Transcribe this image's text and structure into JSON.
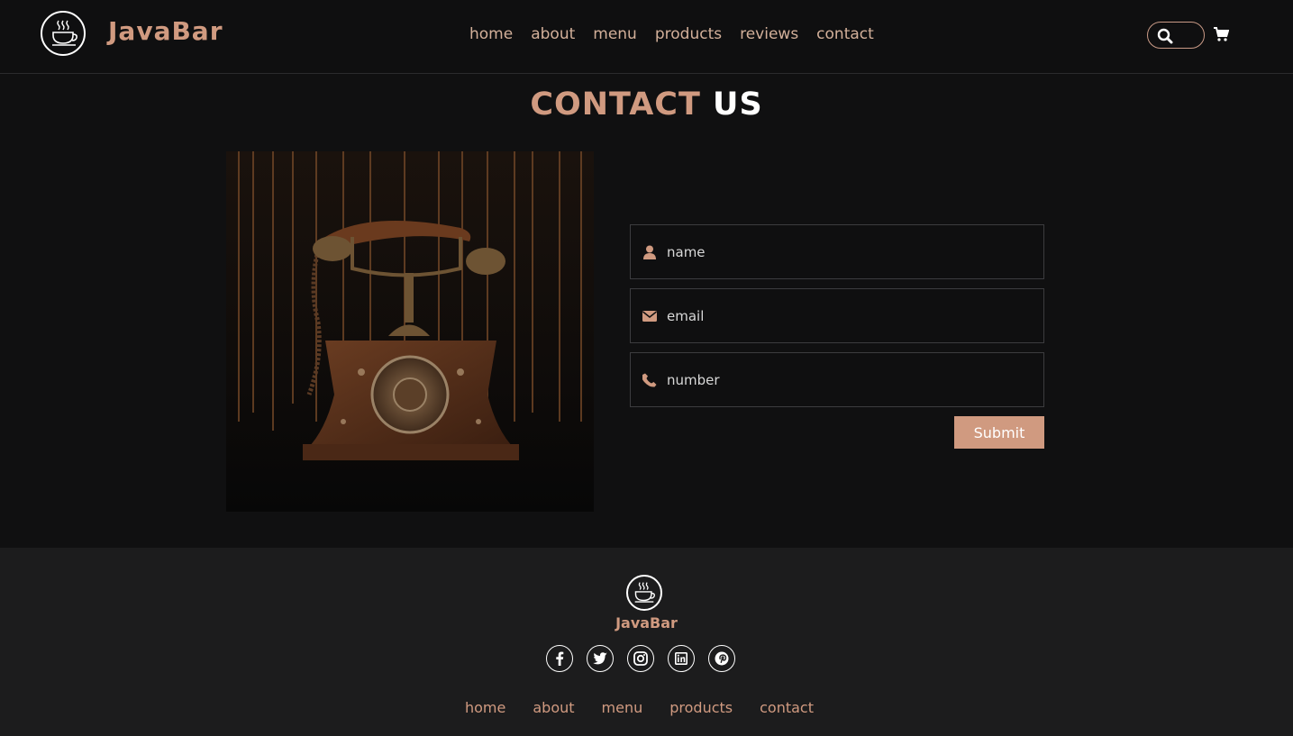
{
  "header": {
    "brand": "JavaBar",
    "nav": [
      "home",
      "about",
      "menu",
      "products",
      "reviews",
      "contact"
    ]
  },
  "section": {
    "title_accent": "CONTACT",
    "title_rest": "US"
  },
  "form": {
    "name_placeholder": "name",
    "email_placeholder": "email",
    "number_placeholder": "number",
    "submit_label": "Submit"
  },
  "footer": {
    "brand": "JavaBar",
    "socials": [
      "facebook-icon",
      "twitter-icon",
      "instagram-icon",
      "linkedin-icon",
      "pinterest-icon"
    ],
    "nav": [
      "home",
      "about",
      "menu",
      "products",
      "contact"
    ]
  },
  "colors": {
    "accent": "#d09a80",
    "background": "#101011",
    "footer_bg": "#1c1c1d"
  }
}
